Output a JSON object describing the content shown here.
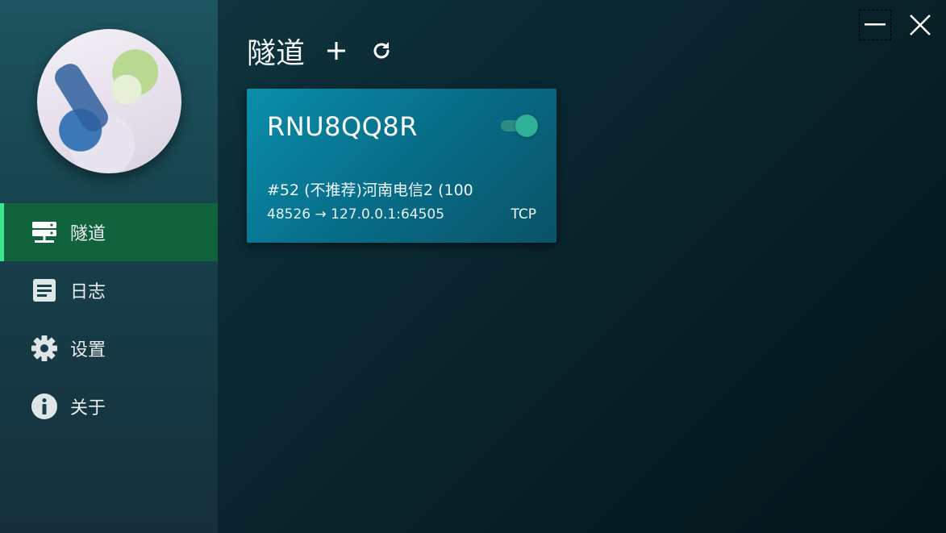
{
  "header": {
    "title": "隧道",
    "add_icon": "plus-icon",
    "refresh_icon": "refresh-icon"
  },
  "window": {
    "minimize_icon": "minimize-icon",
    "close_icon": "close-icon"
  },
  "sidebar": {
    "avatar": "anime-avatar",
    "items": [
      {
        "label": "隧道",
        "icon": "server-icon",
        "active": true
      },
      {
        "label": "日志",
        "icon": "document-icon",
        "active": false
      },
      {
        "label": "设置",
        "icon": "gear-icon",
        "active": false
      },
      {
        "label": "关于",
        "icon": "info-icon",
        "active": false
      }
    ]
  },
  "tunnels": [
    {
      "name": "RNU8QQ8R",
      "enabled": true,
      "node": "#52 (不推荐)河南电信2 (100",
      "route": "48526 → 127.0.0.1:64505",
      "protocol": "TCP"
    }
  ],
  "colors": {
    "active_nav_bg": "#11633e",
    "active_nav_indicator": "#3ee58f",
    "card_bg": "#0a8eaa",
    "toggle_knob": "#2fb198"
  }
}
